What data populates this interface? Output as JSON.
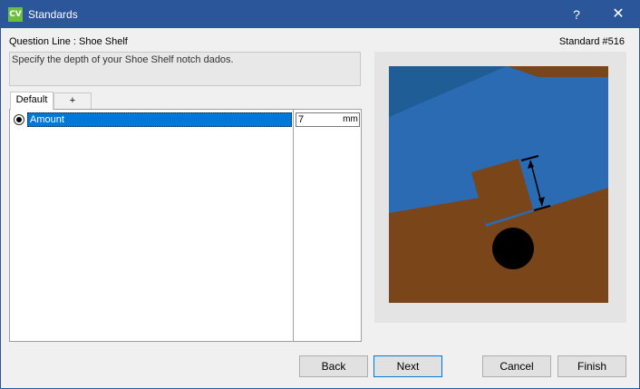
{
  "window": {
    "title": "Standards",
    "app_icon_text": "CV",
    "help_glyph": "?",
    "close_glyph": "✕"
  },
  "header": {
    "question_line": "Question Line : Shoe Shelf",
    "standard_number": "Standard #516",
    "description": "Specify the depth of your Shoe Shelf notch dados."
  },
  "tabs": [
    {
      "label": "Default"
    },
    {
      "label": "+"
    }
  ],
  "grid": {
    "rows": [
      {
        "label": "Amount",
        "value": "7",
        "unit": "mm",
        "selected": true
      }
    ]
  },
  "buttons": {
    "back": "Back",
    "next": "Next",
    "cancel": "Cancel",
    "finish": "Finish"
  },
  "colors": {
    "titlebar": "#2b579a",
    "selection": "#0078d7",
    "panel_blue": "#2a6bb3",
    "panel_dark_blue": "#1f5d96",
    "wood_brown": "#7a4519"
  }
}
